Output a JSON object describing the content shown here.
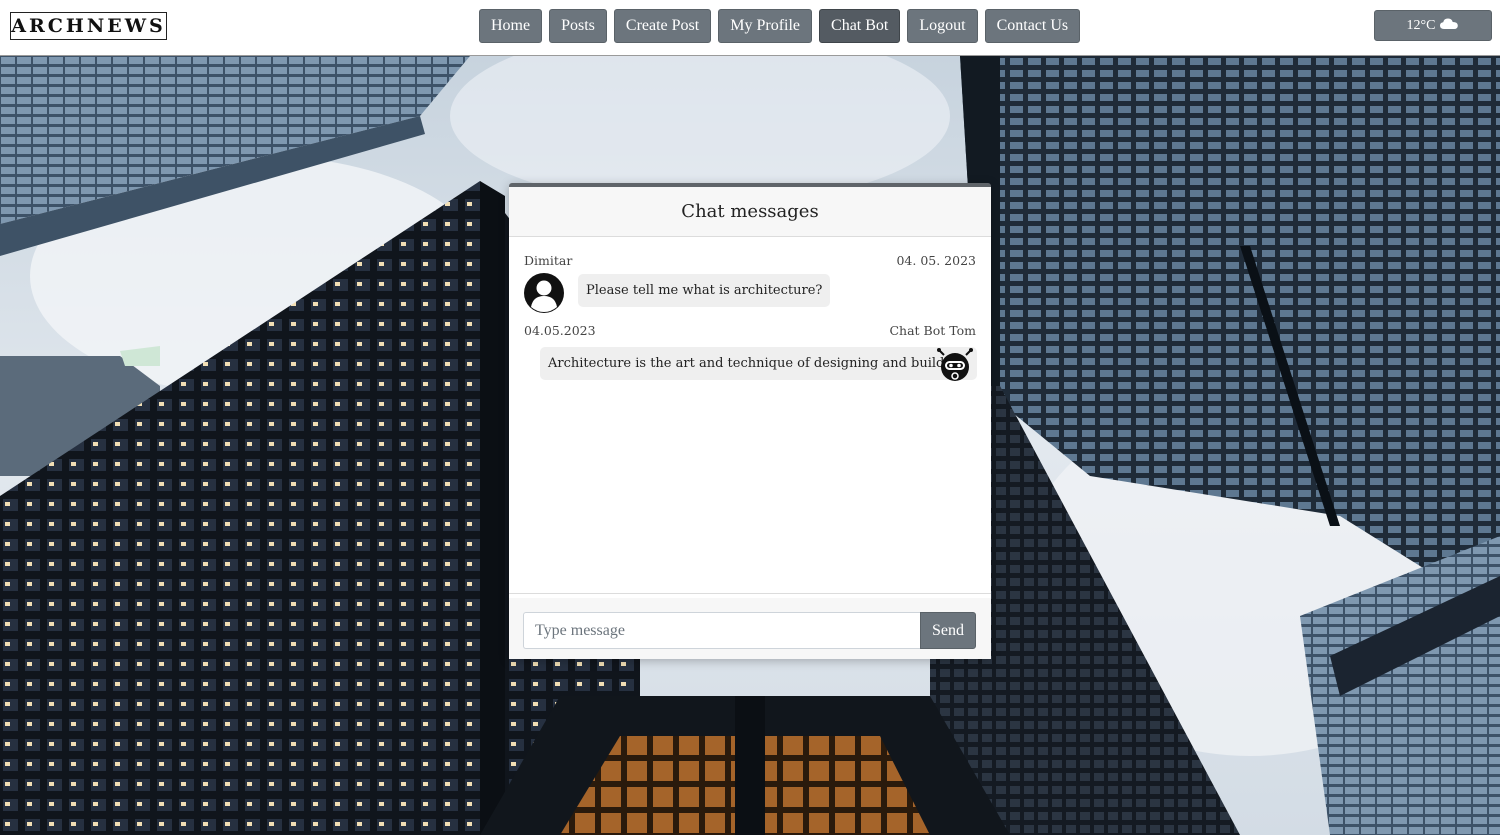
{
  "brand": {
    "logo_text": "ARCHNEWS"
  },
  "nav": {
    "items": [
      {
        "label": "Home",
        "active": false
      },
      {
        "label": "Posts",
        "active": false
      },
      {
        "label": "Create Post",
        "active": false
      },
      {
        "label": "My Profile",
        "active": false
      },
      {
        "label": "Chat Bot",
        "active": true
      },
      {
        "label": "Logout",
        "active": false
      },
      {
        "label": "Contact Us",
        "active": false
      }
    ]
  },
  "weather": {
    "temperature": "12°C",
    "icon": "cloud-icon"
  },
  "chat": {
    "title": "Chat messages",
    "messages": [
      {
        "author": "Dimitar",
        "date": "04. 05. 2023",
        "text": "Please tell me what is architecture?",
        "avatar": "user-avatar-icon"
      },
      {
        "author": "Chat Bot Tom",
        "date": "04.05.2023",
        "text": "Architecture is the art and technique of designing and building.",
        "avatar": "robot-avatar-icon"
      }
    ],
    "input": {
      "placeholder": "Type message",
      "value": ""
    },
    "send_label": "Send"
  },
  "colors": {
    "button": "#6c757d",
    "button_active": "#545b62",
    "card_border": "#5f6469",
    "bubble": "#efefef"
  }
}
